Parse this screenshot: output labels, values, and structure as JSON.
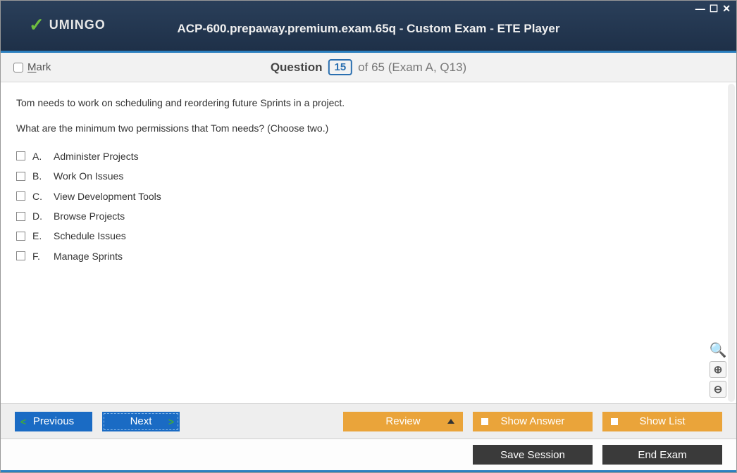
{
  "window": {
    "title": "ACP-600.prepaway.premium.exam.65q - Custom Exam - ETE Player",
    "brand": "UMINGO"
  },
  "questionbar": {
    "mark_label": "Mark",
    "word": "Question",
    "number": "15",
    "suffix": "of 65 (Exam A, Q13)"
  },
  "question": {
    "text1": "Tom needs to work on scheduling and reordering future Sprints in a project.",
    "text2": "What are the minimum two permissions that Tom needs? (Choose two.)",
    "answers": [
      {
        "letter": "A.",
        "text": "Administer Projects"
      },
      {
        "letter": "B.",
        "text": "Work On Issues"
      },
      {
        "letter": "C.",
        "text": "View Development Tools"
      },
      {
        "letter": "D.",
        "text": "Browse Projects"
      },
      {
        "letter": "E.",
        "text": "Schedule Issues"
      },
      {
        "letter": "F.",
        "text": "Manage Sprints"
      }
    ]
  },
  "toolbar": {
    "previous": "Previous",
    "next": "Next",
    "review": "Review",
    "show_answer": "Show Answer",
    "show_list": "Show List"
  },
  "bottombar": {
    "save_session": "Save Session",
    "end_exam": "End Exam"
  }
}
